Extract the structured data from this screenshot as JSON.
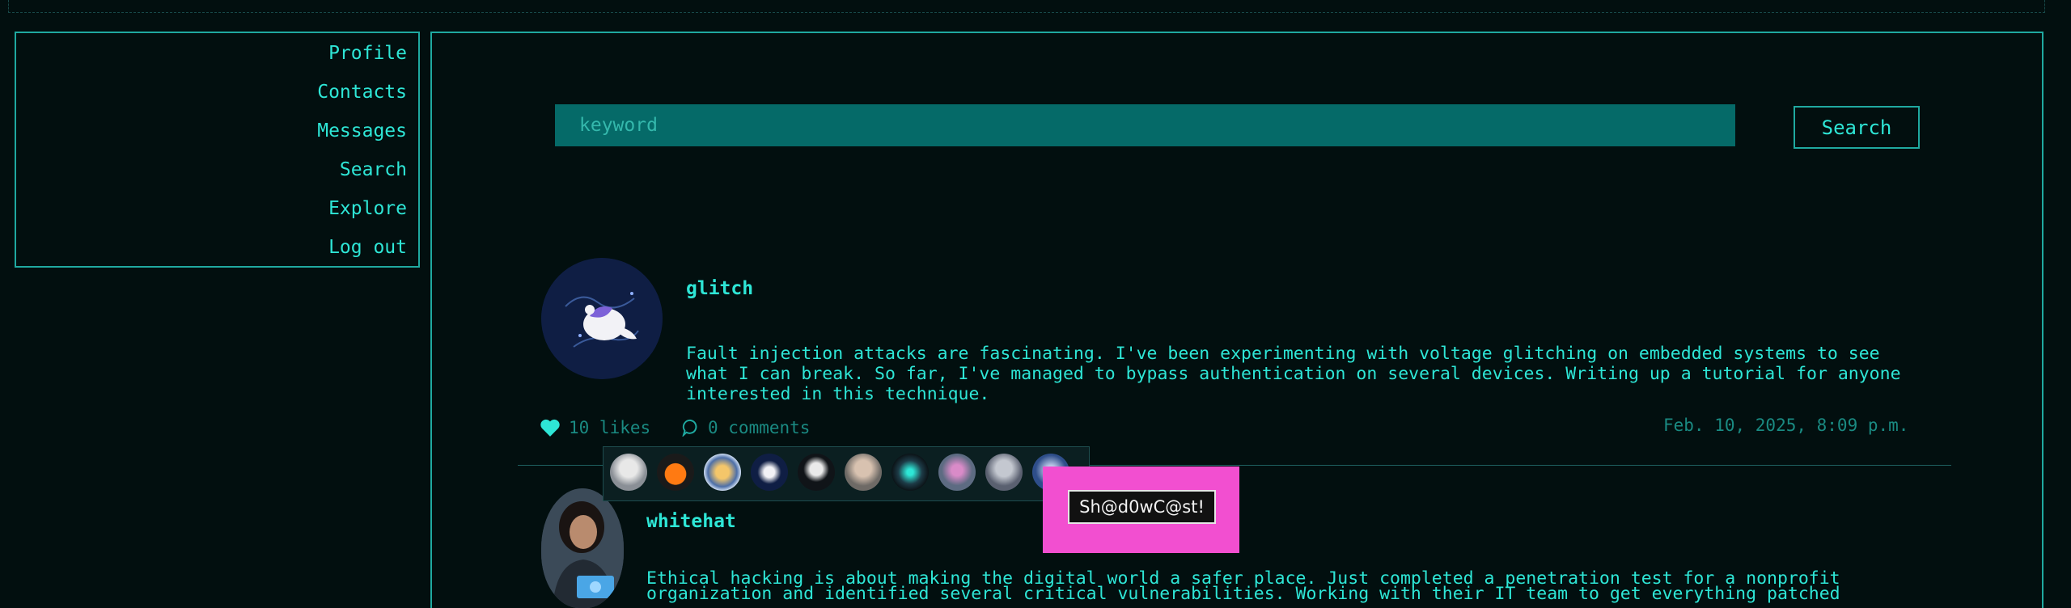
{
  "nav": {
    "items": [
      {
        "label": "Profile"
      },
      {
        "label": "Contacts"
      },
      {
        "label": "Messages"
      },
      {
        "label": "Search"
      },
      {
        "label": "Explore"
      },
      {
        "label": "Log out"
      }
    ]
  },
  "search": {
    "placeholder": "keyword",
    "value": "",
    "button_label": "Search"
  },
  "posts": [
    {
      "username": "glitch",
      "text": "Fault injection attacks are fascinating. I've been experimenting with voltage glitching on embedded systems to see what I can break. So far, I've managed to bypass authentication on several devices. Writing up a tutorial for anyone interested in this technique.",
      "likes": "10 likes",
      "comments": "0 comments",
      "timestamp": "Feb. 10, 2025, 8:09 p.m."
    },
    {
      "username": "whitehat",
      "text": "Ethical hacking is about making the digital world a safer place. Just completed a penetration test for a nonprofit organization and identified several critical vulnerabilities. Working with their IT team to get everything patched"
    }
  ],
  "likers_tooltip": "Sh@d0wC@st!",
  "colors": {
    "background": "#020f0f",
    "accent": "#2ee6d6",
    "border": "#1fa9a0",
    "input_bg": "#056a68",
    "muted": "#1a8a82",
    "highlight": "#f24fd0"
  }
}
